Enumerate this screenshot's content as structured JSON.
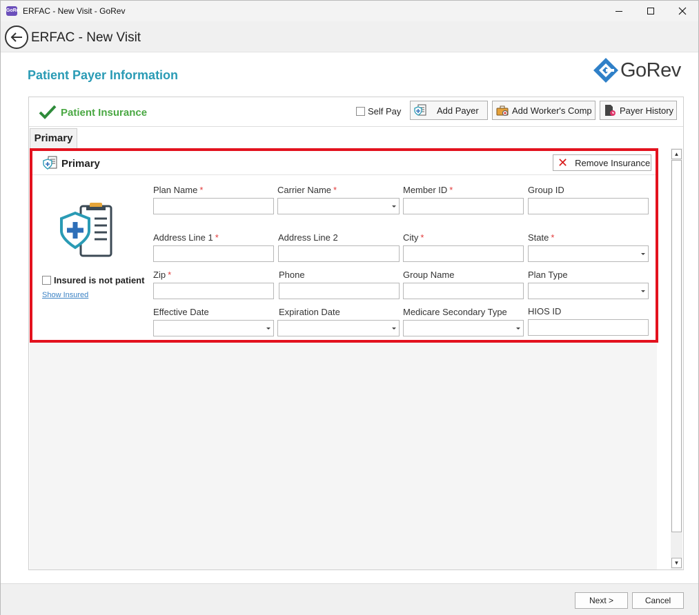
{
  "window": {
    "title": "ERFAC - New Visit - GoRev",
    "app_icon_text": "GoRev"
  },
  "header": {
    "title": "ERFAC - New Visit"
  },
  "page": {
    "title": "Patient Payer Information",
    "logo_text": "GoRev"
  },
  "panel": {
    "title": "Patient Insurance",
    "self_pay_label": "Self Pay",
    "add_payer_label": "Add Payer",
    "add_workers_comp_label": "Add Worker's Comp",
    "payer_history_label": "Payer History",
    "tab_label": "Primary"
  },
  "card": {
    "title": "Primary",
    "remove_label": "Remove Insurance",
    "insured_not_patient_label": "Insured is not patient",
    "show_insured_label": "Show Insured"
  },
  "fields": {
    "plan_name": {
      "label": "Plan Name",
      "required": "*",
      "value": ""
    },
    "carrier_name": {
      "label": "Carrier Name",
      "required": "*",
      "value": ""
    },
    "member_id": {
      "label": "Member ID",
      "required": "*",
      "value": ""
    },
    "group_id": {
      "label": "Group ID",
      "value": ""
    },
    "address1": {
      "label": "Address Line 1",
      "required": "*",
      "value": ""
    },
    "address2": {
      "label": "Address Line 2",
      "value": ""
    },
    "city": {
      "label": "City",
      "required": "*",
      "value": ""
    },
    "state": {
      "label": "State",
      "required": "*",
      "value": ""
    },
    "zip": {
      "label": "Zip",
      "required": "*",
      "value": ""
    },
    "phone": {
      "label": "Phone",
      "value": ""
    },
    "group_name": {
      "label": "Group Name",
      "value": ""
    },
    "plan_type": {
      "label": "Plan Type",
      "value": ""
    },
    "effective_date": {
      "label": "Effective Date",
      "value": ""
    },
    "expiration_date": {
      "label": "Expiration Date",
      "value": ""
    },
    "medicare_secondary_type": {
      "label": "Medicare Secondary Type",
      "value": ""
    },
    "hios_id": {
      "label": "HIOS ID",
      "value": ""
    }
  },
  "footer": {
    "next_label": "Next >",
    "cancel_label": "Cancel"
  },
  "colors": {
    "accent": "#2a9bb5",
    "success": "#4aa843",
    "highlight": "#e3121e",
    "required": "#e23a3a",
    "link": "#3b82c4"
  }
}
